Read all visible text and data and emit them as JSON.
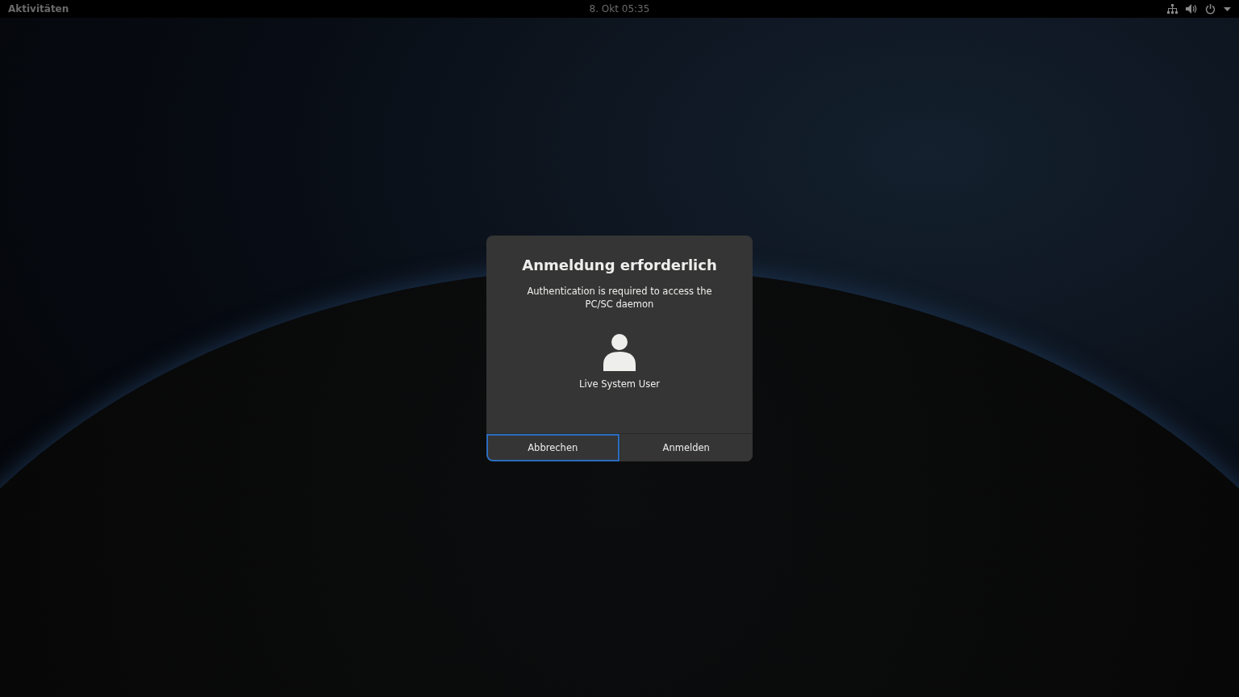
{
  "top_bar": {
    "activities": "Aktivitäten",
    "clock": "8. Okt  05:35"
  },
  "dialog": {
    "title": "Anmeldung erforderlich",
    "message": "Authentication is required to access the PC/SC daemon",
    "user_name": "Live System User",
    "buttons": [
      {
        "label": "Abbrechen",
        "focused": true
      },
      {
        "label": "Anmelden",
        "focused": false
      }
    ]
  }
}
